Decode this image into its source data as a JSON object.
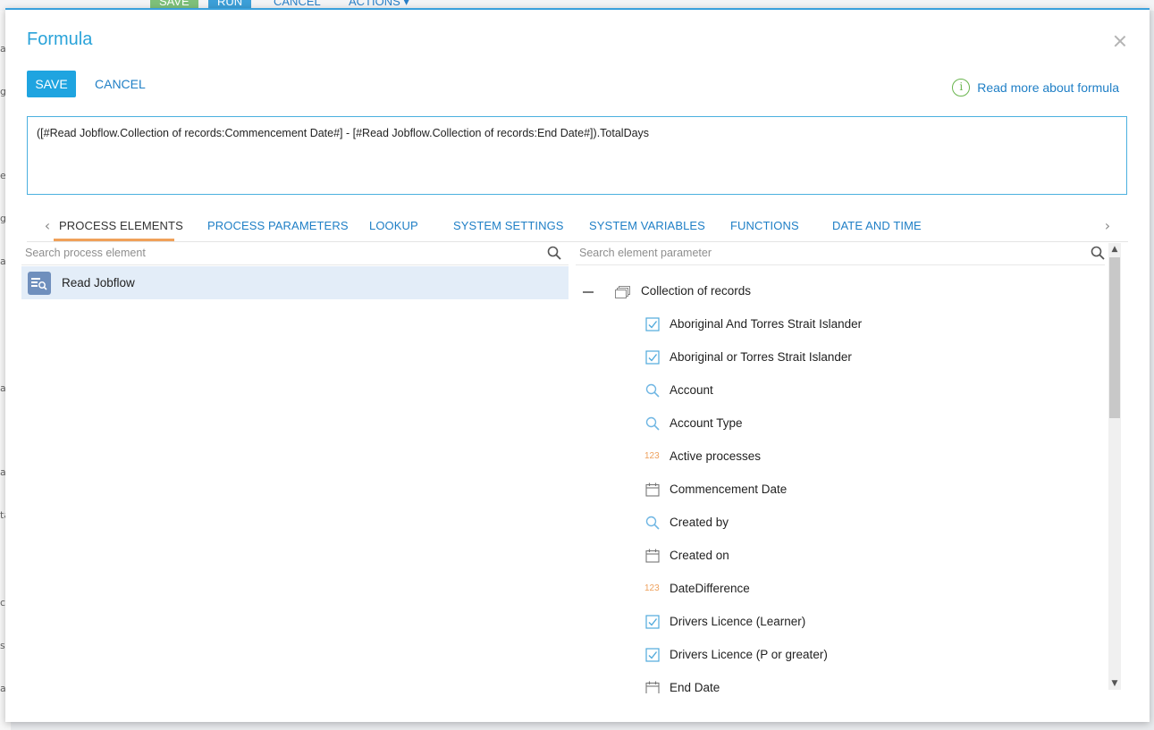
{
  "background": {
    "save_label": "SAVE",
    "run_label": "RUN",
    "cancel_label": "CANCEL",
    "actions_label": "ACTIONS ▾",
    "left_letters": [
      "a",
      "g",
      "e",
      "g",
      "ai",
      "a",
      "at",
      "ta",
      "c",
      "se",
      "at"
    ]
  },
  "dialog": {
    "title": "Formula",
    "save_label": "SAVE",
    "cancel_label": "CANCEL",
    "read_more_label": "Read more about formula",
    "formula_text": "([#Read Jobflow.Collection of records:Commencement Date#] - [#Read Jobflow.Collection of records:End Date#]).TotalDays"
  },
  "tabs": [
    {
      "label": "PROCESS ELEMENTS",
      "active": true
    },
    {
      "label": "PROCESS PARAMETERS"
    },
    {
      "label": "LOOKUP"
    },
    {
      "label": "SYSTEM SETTINGS"
    },
    {
      "label": "SYSTEM VARIABLES"
    },
    {
      "label": "FUNCTIONS"
    },
    {
      "label": "DATE AND TIME"
    }
  ],
  "left_panel": {
    "search_placeholder": "Search process element",
    "items": [
      {
        "label": "Read Jobflow",
        "selected": true
      }
    ]
  },
  "right_panel": {
    "search_placeholder": "Search element parameter",
    "collection_label": "Collection of records",
    "items": [
      {
        "label": "Aboriginal And Torres Strait Islander",
        "icon": "checkbox-icon"
      },
      {
        "label": "Aboriginal or Torres Strait Islander",
        "icon": "checkbox-icon"
      },
      {
        "label": "Account",
        "icon": "lookup-icon"
      },
      {
        "label": "Account Type",
        "icon": "lookup-icon"
      },
      {
        "label": "Active processes",
        "icon": "number-icon",
        "icon_text": "123"
      },
      {
        "label": "Commencement Date",
        "icon": "calendar-icon"
      },
      {
        "label": "Created by",
        "icon": "lookup-icon"
      },
      {
        "label": "Created on",
        "icon": "calendar-icon"
      },
      {
        "label": "DateDifference",
        "icon": "number-icon",
        "icon_text": "123"
      },
      {
        "label": "Drivers Licence (Learner)",
        "icon": "checkbox-icon"
      },
      {
        "label": "Drivers Licence (P or greater)",
        "icon": "checkbox-icon"
      },
      {
        "label": "End Date",
        "icon": "calendar-icon"
      }
    ]
  },
  "colors": {
    "accent": "#1fa4e0",
    "link": "#1f7fc6",
    "active_tab_underline": "#f0a15a",
    "selected_row": "#e3edf8",
    "info_icon": "#6ab54e",
    "number_icon": "#eea05c"
  }
}
